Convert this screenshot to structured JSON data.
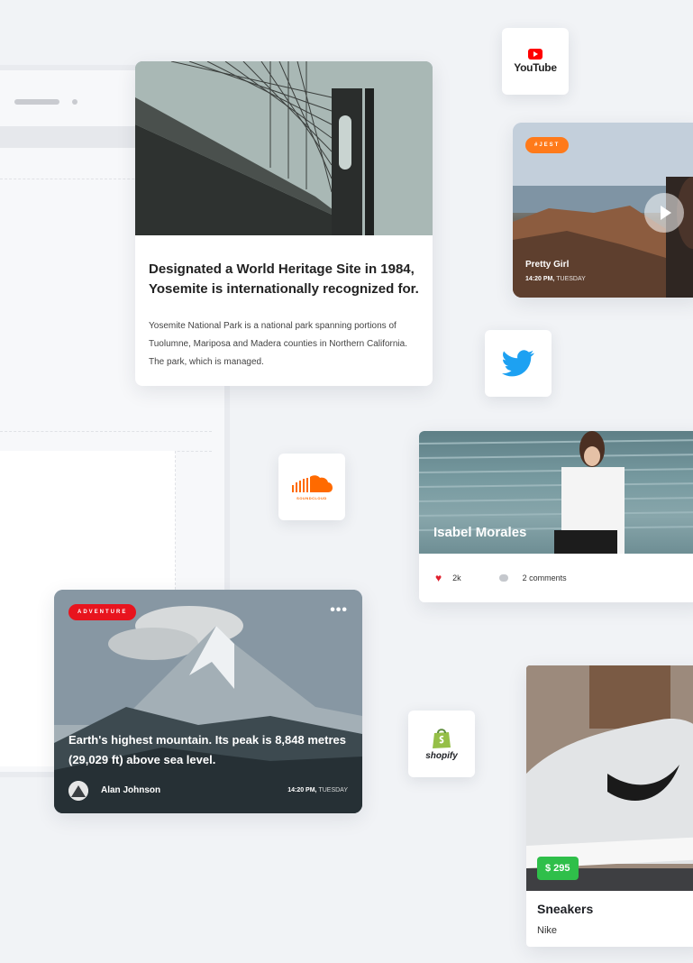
{
  "yosemite_card": {
    "title": "Designated a World Heritage Site in 1984, Yosemite is internationally recognized for.",
    "body": "Yosemite National Park is a national park spanning portions of Tuolumne, Mariposa and Madera counties in Northern California. The park, which is managed."
  },
  "video_card": {
    "tag": "#JEST",
    "name": "Pretty Girl",
    "time": "14:20 PM,",
    "day": "TUESDAY",
    "tag_color": "#ff7a1a"
  },
  "social_icons": {
    "youtube_label": "YouTube",
    "soundcloud_label": "SOUNDCLOUD",
    "shopify_label": "shopify"
  },
  "isabel_card": {
    "name": "Isabel Morales",
    "likes": "2k",
    "comments": "2 comments"
  },
  "mountain_card": {
    "tag": "ADVENTURE",
    "more": "•••",
    "title": "Earth's highest mountain. Its peak is 8,848 metres (29,029 ft) above sea level.",
    "author": "Alan Johnson",
    "time": "14:20 PM,",
    "day": "TUESDAY",
    "tag_color": "#e8141e"
  },
  "sneakers_card": {
    "price": "$ 295",
    "title": "Sneakers",
    "brand": "Nike",
    "price_color": "#2fbf4a"
  },
  "colors": {
    "youtube_red": "#ff0000",
    "twitter_blue": "#1da1f2",
    "soundcloud_orange": "#ff6a00",
    "shopify_green": "#95bf47"
  }
}
